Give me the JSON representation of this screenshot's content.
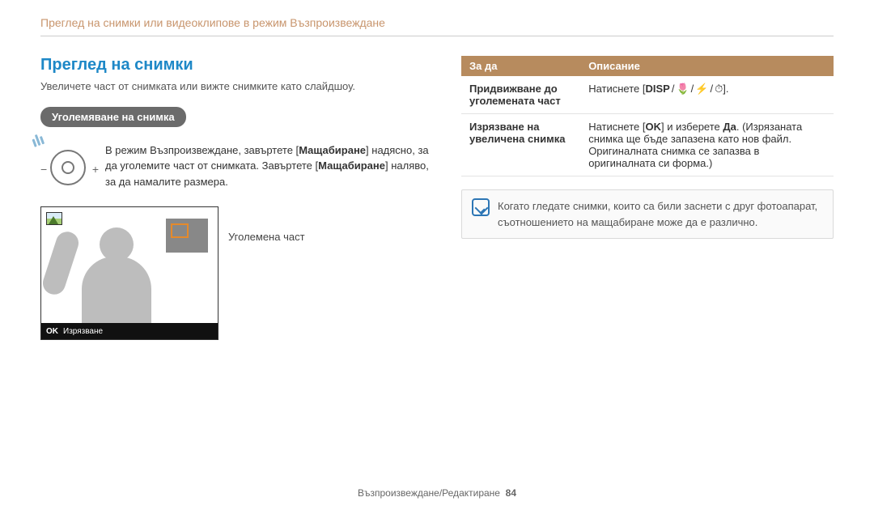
{
  "breadcrumb": "Преглед на снимки или видеоклипове в режим Възпроизвеждане",
  "section": {
    "title": "Преглед на снимки",
    "intro": "Увеличете част от снимката или вижте снимките като слайдшоу.",
    "pill": "Уголемяване на снимка",
    "instruction": {
      "pre": "В режим Възпроизвеждане, завъртете [",
      "kw1": "Мащабиране",
      "mid1": "] надясно, за да уголемите част от снимката. Завъртете [",
      "kw2": "Мащабиране",
      "post": "] наляво, за да намалите размера."
    },
    "dial": {
      "minus": "−",
      "plus": "+"
    },
    "callout": "Уголемена част",
    "footer_bar": {
      "ok": "OK",
      "label": "Изрязване"
    }
  },
  "table": {
    "headers": {
      "h1": "За да",
      "h2": "Описание"
    },
    "rows": [
      {
        "label": "Придвижване до уголемената част",
        "desc": {
          "pre": "Натиснете [",
          "k1": "DISP",
          "k2": "🌷",
          "k3": "⚡",
          "k4": "⏱",
          "post": "]."
        }
      },
      {
        "label": "Изрязване на увеличена снимка",
        "desc": {
          "pre": "Натиснете [",
          "ok": "OK",
          "mid": "] и изберете ",
          "bold": "Да",
          "post": ". (Изрязаната снимка ще бъде запазена като нов файл. Оригиналната снимка се запазва в оригиналната си форма.)"
        }
      }
    ]
  },
  "note": "Когато гледате снимки, които са били заснети с друг фотоапарат, съотношението на мащабиране може да е различно.",
  "page_footer": {
    "section": "Възпроизвеждане/Редактиране",
    "page": "84"
  }
}
